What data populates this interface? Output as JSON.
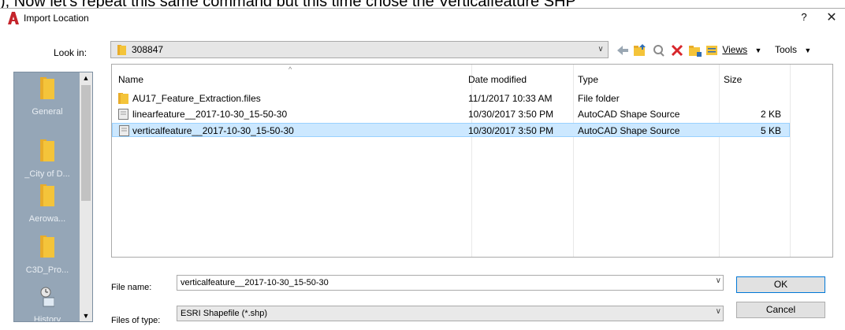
{
  "background_text": "), Now let's repeat this same command but this time chose the Verticalfeature SHP",
  "dialog": {
    "title": "Import Location",
    "help_label": "?",
    "close_label": "✕"
  },
  "look_in": {
    "label": "Look in:",
    "value": "308847"
  },
  "toolbar": {
    "views_label": "Views",
    "tools_label": "Tools"
  },
  "places": [
    {
      "label": "General",
      "icon": "folder-icon"
    },
    {
      "label": "_City of D...",
      "icon": "folder-icon"
    },
    {
      "label": "Aerowa...",
      "icon": "folder-icon"
    },
    {
      "label": "C3D_Pro...",
      "icon": "folder-icon"
    },
    {
      "label": "History",
      "icon": "history-icon"
    }
  ],
  "file_list": {
    "columns": [
      "Name",
      "Date modified",
      "Type",
      "Size"
    ],
    "rows": [
      {
        "name": "AU17_Feature_Extraction.files",
        "date": "11/1/2017 10:33 AM",
        "type": "File folder",
        "size": "",
        "icon": "folder-icon",
        "selected": false
      },
      {
        "name": "linearfeature__2017-10-30_15-50-30",
        "date": "10/30/2017 3:50 PM",
        "type": "AutoCAD Shape Source",
        "size": "2 KB",
        "icon": "shape-file-icon",
        "selected": false
      },
      {
        "name": "verticalfeature__2017-10-30_15-50-30",
        "date": "10/30/2017 3:50 PM",
        "type": "AutoCAD Shape Source",
        "size": "5 KB",
        "icon": "shape-file-icon",
        "selected": true
      }
    ]
  },
  "file_name": {
    "label": "File name:",
    "value": "verticalfeature__2017-10-30_15-50-30"
  },
  "file_type": {
    "label": "Files of type:",
    "value": "ESRI Shapefile  (*.shp)"
  },
  "buttons": {
    "ok": "OK",
    "cancel": "Cancel"
  },
  "colors": {
    "places_bg": "#95a6b7",
    "selection_bg": "#cce8ff",
    "folder_yellow": "#f4c43a",
    "app_red": "#c4242b"
  }
}
